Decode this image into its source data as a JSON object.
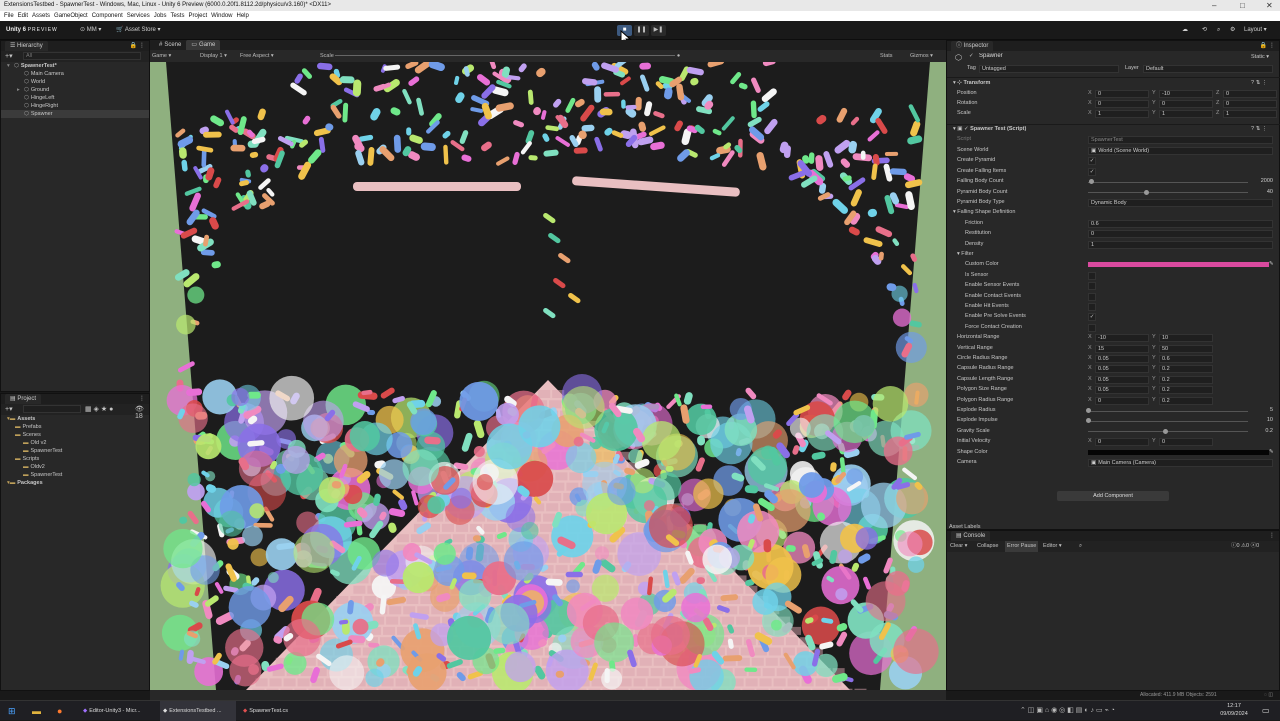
{
  "window": {
    "title": "ExtensionsTestbed - SpawnerTest - Windows, Mac, Linux - Unity 6 Preview (6000.0.20f1.8112.2d/physicu/v3.160)* <DX11>"
  },
  "menu": [
    "File",
    "Edit",
    "Assets",
    "GameObject",
    "Component",
    "Services",
    "Jobs",
    "Tests",
    "Project",
    "Window",
    "Help"
  ],
  "toolbar": {
    "brand": "Unity 6",
    "brand_sub": "PREVIEW",
    "account": "MM",
    "asset_store": "Asset Store",
    "layout": "Layout"
  },
  "play_controls": [
    {
      "name": "play-button",
      "glyph": "■"
    },
    {
      "name": "pause-button",
      "glyph": "❚❚"
    },
    {
      "name": "step-button",
      "glyph": "▶❚"
    }
  ],
  "hierarchy": {
    "tab": "Hierarchy",
    "search_placeholder": "All",
    "items": [
      {
        "label": "SpawnerTest*",
        "indent": 0,
        "arrow": "▾"
      },
      {
        "label": "Main Camera",
        "indent": 1,
        "arrow": ""
      },
      {
        "label": "World",
        "indent": 1,
        "arrow": ""
      },
      {
        "label": "Ground",
        "indent": 1,
        "arrow": "▸"
      },
      {
        "label": "HingeLeft",
        "indent": 1,
        "arrow": ""
      },
      {
        "label": "HingeRight",
        "indent": 1,
        "arrow": ""
      },
      {
        "label": "Spawner",
        "indent": 1,
        "arrow": "",
        "selected": true
      }
    ]
  },
  "scene_tabs": [
    {
      "label": "Scene"
    },
    {
      "label": "Game",
      "active": true
    }
  ],
  "game_toolbar": {
    "mode": "Game",
    "display": "Display 1",
    "aspect": "Free Aspect",
    "scale": "Scale",
    "stats": "Stats",
    "gizmos": "Gizmos"
  },
  "project": {
    "tab": "Project",
    "count": "18",
    "items": [
      {
        "label": "Assets",
        "indent": 0,
        "bold": true
      },
      {
        "label": "Prefabs",
        "indent": 1
      },
      {
        "label": "Scenes",
        "indent": 1
      },
      {
        "label": "Old v2",
        "indent": 2
      },
      {
        "label": "SpawnerTest",
        "indent": 2
      },
      {
        "label": "Scripts",
        "indent": 1
      },
      {
        "label": "Oldv2",
        "indent": 2
      },
      {
        "label": "SpawnerTest",
        "indent": 2
      },
      {
        "label": "Packages",
        "indent": 0,
        "bold": true
      }
    ]
  },
  "inspector": {
    "tab": "Inspector",
    "object_name": "Spawner",
    "static": "Static",
    "tag_label": "Tag",
    "tag_value": "Untagged",
    "layer_label": "Layer",
    "layer_value": "Default",
    "transform_title": "Transform",
    "transform_rows": [
      {
        "label": "Position",
        "x": "0",
        "y": "-10",
        "z": "0"
      },
      {
        "label": "Rotation",
        "x": "0",
        "y": "0",
        "z": "0"
      },
      {
        "label": "Scale",
        "x": "1",
        "y": "1",
        "z": "1"
      }
    ],
    "script_title": "Spawner Test (Script)",
    "script_field": "SpawnerTest",
    "script_label": "Script",
    "props": [
      {
        "label": "Scene World",
        "kind": "obj",
        "value": "World (Scene World)"
      },
      {
        "label": "Create Pyramid",
        "kind": "check",
        "value": "✓"
      },
      {
        "label": "Create Falling Items",
        "kind": "check",
        "value": "✓"
      },
      {
        "label": "Falling Body Count",
        "kind": "slider",
        "value": "2000",
        "frac": 0.02
      },
      {
        "label": "Pyramid Body Count",
        "kind": "slider",
        "value": "40",
        "frac": 0.36
      },
      {
        "label": "Pyramid Body Type",
        "kind": "enum",
        "value": "Dynamic Body"
      },
      {
        "label": "Falling Shape Definition",
        "kind": "header",
        "value": ""
      },
      {
        "label": "Friction",
        "kind": "text",
        "value": "0.6"
      },
      {
        "label": "Restitution",
        "kind": "text",
        "value": "0"
      },
      {
        "label": "Density",
        "kind": "text",
        "value": "1"
      },
      {
        "label": "Filter",
        "kind": "subheader",
        "value": ""
      },
      {
        "label": "Custom Color",
        "kind": "color",
        "value": "#d94a9f"
      },
      {
        "label": "Is Sensor",
        "kind": "check",
        "value": ""
      },
      {
        "label": "Enable Sensor Events",
        "kind": "check",
        "value": ""
      },
      {
        "label": "Enable Contact Events",
        "kind": "check",
        "value": ""
      },
      {
        "label": "Enable Hit Events",
        "kind": "check",
        "value": ""
      },
      {
        "label": "Enable Pre Solve Events",
        "kind": "check",
        "value": "✓"
      },
      {
        "label": "Force Contact Creation",
        "kind": "check",
        "value": ""
      },
      {
        "label": "Horizontal Range",
        "kind": "xy",
        "x": "-10",
        "y": "10"
      },
      {
        "label": "Vertical Range",
        "kind": "xy",
        "x": "15",
        "y": "50"
      },
      {
        "label": "Circle Radius Range",
        "kind": "xy",
        "x": "0.05",
        "y": "0.6"
      },
      {
        "label": "Capsule Radius Range",
        "kind": "xy",
        "x": "0.05",
        "y": "0.2"
      },
      {
        "label": "Capsule Length Range",
        "kind": "xy",
        "x": "0.05",
        "y": "0.2"
      },
      {
        "label": "Polygon Size Range",
        "kind": "xy",
        "x": "0.05",
        "y": "0.2"
      },
      {
        "label": "Polygon Radius Range",
        "kind": "xy",
        "x": "0",
        "y": "0.2"
      },
      {
        "label": "Explode Radius",
        "kind": "slider",
        "value": "5",
        "frac": 0.0
      },
      {
        "label": "Explode Impulse",
        "kind": "slider",
        "value": "10",
        "frac": 0.0
      },
      {
        "label": "Gravity Scale",
        "kind": "slider",
        "value": "0.2",
        "frac": 0.48
      },
      {
        "label": "Initial Velocity",
        "kind": "xy",
        "x": "0",
        "y": "0"
      },
      {
        "label": "Shape Color",
        "kind": "color",
        "value": "#050505"
      },
      {
        "label": "Camera",
        "kind": "obj",
        "value": "Main Camera (Camera)"
      }
    ],
    "add_component": "Add Component",
    "asset_labels": "Asset Labels"
  },
  "console": {
    "tab": "Console",
    "clear": "Clear",
    "collapse": "Collapse",
    "error_pause": "Error Pause",
    "editor": "Editor",
    "counts": [
      "0",
      "0",
      "0"
    ]
  },
  "status": {
    "memory": "Allocated: 411.9 MB Objects: 2591"
  },
  "taskbar": {
    "apps": [
      {
        "label": "Editor-Unity3 - Micr..."
      },
      {
        "label": "ExtensionsTestbed ..."
      },
      {
        "label": "SpawnerTest.cs"
      }
    ],
    "time": "12:17",
    "date": "09/09/2024"
  },
  "colors": {
    "accent": "#3d5a80",
    "wall": "#8fb07f",
    "pyramid": "#e9bfc1",
    "game_bg": "#1c1c1c"
  }
}
